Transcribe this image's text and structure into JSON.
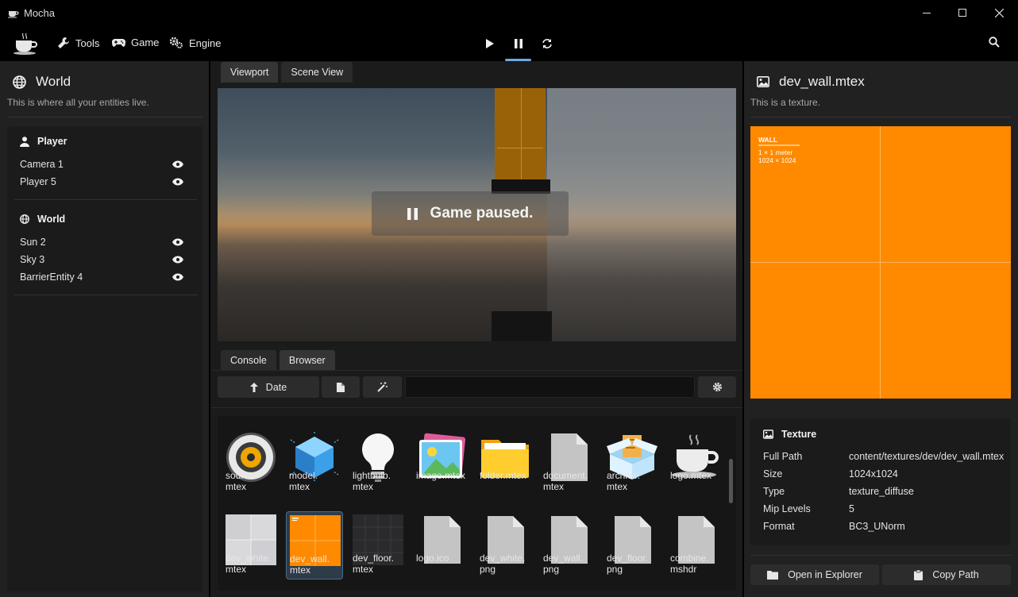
{
  "app": {
    "title": "Mocha"
  },
  "menu": {
    "tools": "Tools",
    "game": "Game",
    "engine": "Engine"
  },
  "left": {
    "title": "World",
    "subtitle": "This is where all your entities live.",
    "groups": [
      {
        "name": "Player",
        "entities": [
          "Camera 1",
          "Player 5"
        ]
      },
      {
        "name": "World",
        "entities": [
          "Sun 2",
          "Sky 3",
          "BarrierEntity 4"
        ]
      }
    ]
  },
  "center": {
    "tabs": [
      "Viewport",
      "Scene View"
    ],
    "active_tab": "Viewport",
    "paused_text": "Game paused.",
    "bottom_tabs": [
      "Console",
      "Browser"
    ],
    "active_bottom_tab": "Browser",
    "sort_label": "Date",
    "search_value": "",
    "assets_row1": [
      {
        "label": "sound.\nmtex",
        "icon": "sound-icon"
      },
      {
        "label": "model.\nmtex",
        "icon": "cube-icon"
      },
      {
        "label": "lightbulb.\nmtex",
        "icon": "lightbulb-icon"
      },
      {
        "label": "image.mtex",
        "icon": "image-icon"
      },
      {
        "label": "folder.mtex",
        "icon": "folder-icon"
      },
      {
        "label": "document.\nmtex",
        "icon": "document-icon"
      },
      {
        "label": "archive.\nmtex",
        "icon": "archive-icon"
      },
      {
        "label": "logo.mtex",
        "icon": "coffee-icon"
      }
    ],
    "assets_row2": [
      {
        "label": "dev_white.\nmtex",
        "icon": "texture-white-icon"
      },
      {
        "label": "dev_wall.\nmtex",
        "icon": "texture-orange-icon"
      },
      {
        "label": "dev_floor.\nmtex",
        "icon": "texture-dark-icon"
      },
      {
        "label": "logo.ico",
        "icon": "file-icon"
      },
      {
        "label": "dev_white.\npng",
        "icon": "file-icon"
      },
      {
        "label": "dev_wall.\npng",
        "icon": "file-icon"
      },
      {
        "label": "dev_floor.\npng",
        "icon": "file-icon"
      },
      {
        "label": "combine.\nmshdr",
        "icon": "file-icon"
      }
    ]
  },
  "right": {
    "title": "dev_wall.mtex",
    "subtitle": "This is a texture.",
    "preview_text": {
      "line1": "WALL",
      "line2": "1 × 1 meter",
      "line3": "1024 × 1024"
    },
    "section": "Texture",
    "properties": [
      {
        "key": "Full Path",
        "value": "content/textures/dev/dev_wall.mtex"
      },
      {
        "key": "Size",
        "value": "1024x1024"
      },
      {
        "key": "Type",
        "value": "texture_diffuse"
      },
      {
        "key": "Mip Levels",
        "value": "5"
      },
      {
        "key": "Format",
        "value": "BC3_UNorm"
      }
    ],
    "open_explorer": "Open in Explorer",
    "copy_path": "Copy Path"
  },
  "colors": {
    "accent": "#6aa8e8",
    "wall": "#ff8a00"
  }
}
